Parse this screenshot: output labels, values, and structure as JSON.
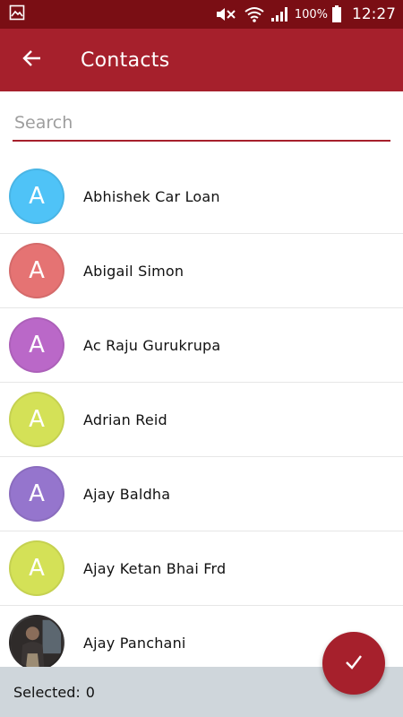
{
  "status_bar": {
    "battery": "100%",
    "time": "12:27",
    "icons": [
      "gallery-icon",
      "mute-icon",
      "wifi-icon",
      "signal-icon",
      "battery-icon"
    ]
  },
  "app_bar": {
    "title": "Contacts",
    "back_icon": "arrow-left-icon"
  },
  "search": {
    "placeholder": "Search",
    "value": ""
  },
  "contacts": [
    {
      "initial": "A",
      "name": "Abhishek Car Loan",
      "color": "#4fc3f7"
    },
    {
      "initial": "A",
      "name": "Abigail Simon",
      "color": "#e57373"
    },
    {
      "initial": "A",
      "name": "Ac Raju Gurukrupa",
      "color": "#ba68c8"
    },
    {
      "initial": "A",
      "name": "Adrian Reid",
      "color": "#d4e157"
    },
    {
      "initial": "A",
      "name": "Ajay Baldha",
      "color": "#9575cd"
    },
    {
      "initial": "A",
      "name": "Ajay Ketan Bhai Frd",
      "color": "#d4e157"
    },
    {
      "initial": "",
      "name": "Ajay Panchani",
      "color": "#2b2727"
    }
  ],
  "footer": {
    "selected_label": "Selected:",
    "selected_count": "0"
  },
  "fab": {
    "icon": "check-icon"
  },
  "colors": {
    "primary": "#a6202c",
    "primary_dark": "#7a0e14",
    "footer_bg": "#cfd6db"
  }
}
